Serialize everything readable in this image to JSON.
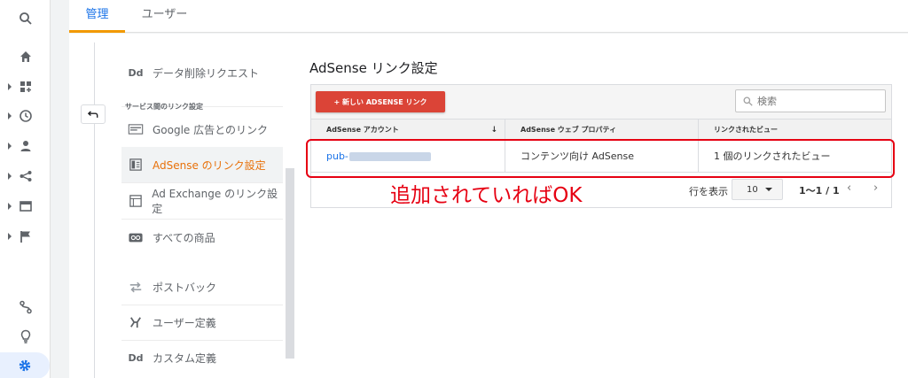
{
  "tabs": [
    {
      "label": "管理",
      "active": true
    },
    {
      "label": "ユーザー",
      "active": false
    }
  ],
  "rail_icons": [
    "search-icon",
    "home-icon",
    "customization-icon",
    "realtime-icon",
    "audience-icon",
    "acquisition-icon",
    "behavior-icon",
    "conversions-icon",
    "attribution-icon",
    "discover-icon",
    "admin-gear-icon"
  ],
  "menu": {
    "items": [
      {
        "icon_text": "Dd",
        "label": "データ削除リクエスト",
        "active": false
      },
      {
        "icon_text": "",
        "label": "Google 広告とのリンク",
        "active": false
      },
      {
        "icon_text": "",
        "label": "AdSense のリンク設定",
        "active": true
      },
      {
        "icon_text": "",
        "label": "Ad Exchange のリンク設定",
        "active": false
      },
      {
        "icon_text": "",
        "label": "すべての商品",
        "active": false
      },
      {
        "icon_text": "",
        "label": "ポストバック",
        "active": false
      },
      {
        "icon_text": "",
        "label": "ユーザー定義",
        "active": false
      },
      {
        "icon_text": "Dd",
        "label": "カスタム定義",
        "active": false
      }
    ],
    "section_title": "サービス間のリンク設定"
  },
  "panel": {
    "title": "AdSense リンク設定",
    "new_button": "+ 新しい ADSENSE リンク",
    "search_placeholder": "検索"
  },
  "table": {
    "headers": [
      "AdSense アカウント",
      "AdSense ウェブ プロパティ",
      "リンクされたビュー"
    ],
    "rows": [
      {
        "account": "pub-",
        "property": "コンテンツ向け AdSense",
        "views": "1 個のリンクされたビュー"
      }
    ]
  },
  "pager": {
    "rows_label": "行を表示",
    "rows_value": "10",
    "range": "1〜1 / 1"
  },
  "annotation": "追加されていればOK",
  "colors": {
    "accent_blue": "#1a73e8",
    "tab_underline": "#f29900",
    "active_menu_text": "#e8710a",
    "new_button_red": "#db4437",
    "annotation_red": "#e60012"
  }
}
